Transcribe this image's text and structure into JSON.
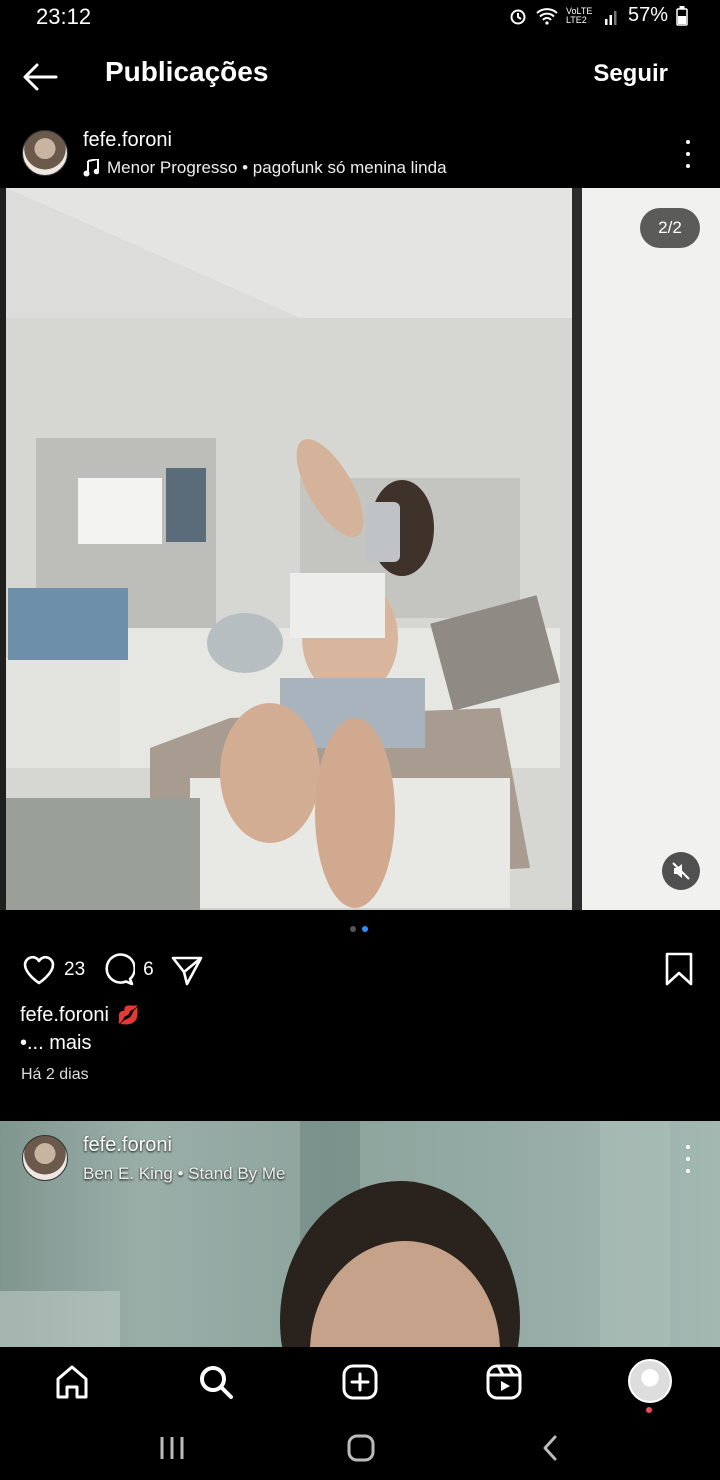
{
  "status_bar": {
    "time": "23:12",
    "network": "VoLTE LTE2",
    "battery": "57%"
  },
  "header": {
    "title": "Publicações",
    "follow_label": "Seguir"
  },
  "post1": {
    "username": "fefe.foroni",
    "audio": "Menor Progresso • pagofunk só menina linda",
    "counter": "2/2",
    "likes": "23",
    "comments": "6",
    "caption_user": "fefe.foroni",
    "caption_emoji": "💋",
    "caption_more": "•... mais",
    "time_ago": "Há 2 dias",
    "carousel_index": 2,
    "carousel_total": 2
  },
  "post2": {
    "username": "fefe.foroni",
    "audio": "Ben E. King • Stand By Me"
  },
  "icons": [
    "back-arrow-icon",
    "music-note-icon",
    "kebab-icon",
    "mute-icon",
    "heart-icon",
    "comment-icon",
    "share-icon",
    "bookmark-icon",
    "home-icon",
    "search-icon",
    "create-icon",
    "reels-icon",
    "profile-icon",
    "recents-icon",
    "home-circle-icon",
    "back-chevron-icon"
  ],
  "colors": {
    "background": "#000000",
    "accent": "#2b8ff6",
    "notification_dot": "#ed4956"
  }
}
